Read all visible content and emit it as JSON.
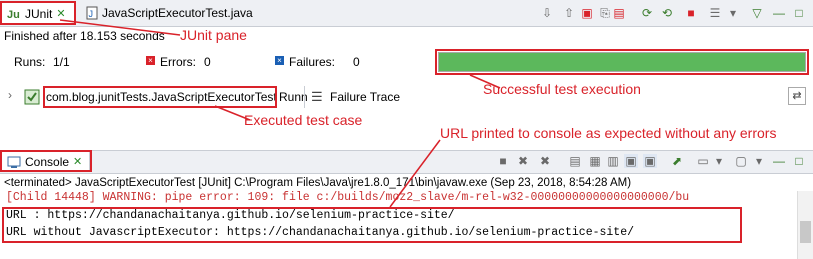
{
  "junit_view": {
    "tabs": [
      {
        "label": "JUnit",
        "icon": "junit-icon",
        "close_icon": "close-icon"
      },
      {
        "label": "JavaScriptExecutorTest.java",
        "icon": "java-file-icon"
      }
    ],
    "status_text": "Finished after 18.153 seconds",
    "runs_label": "Runs:",
    "runs_value": "1/1",
    "errors_label": "Errors:",
    "errors_value": "0",
    "failures_label": "Failures:",
    "failures_value": "0",
    "progress_fraction": 1.0,
    "progress_color": "#5cb85c",
    "test_item": "com.blog.junitTests.JavaScriptExecutorTest",
    "test_item_suffix": "Runn",
    "failure_trace_label": "Failure Trace"
  },
  "console_view": {
    "tab_label": "Console",
    "terminated_line": "<terminated> JavaScriptExecutorTest [JUnit] C:\\Program Files\\Java\\jre1.8.0_171\\bin\\javaw.exe (Sep 23, 2018, 8:54:28 AM)",
    "lines": [
      {
        "text": "[Child 14448] WARNING: pipe error: 109: file c:/builds/moz2_slave/m-rel-w32-00000000000000000000/bu",
        "color": "#c83232"
      },
      {
        "text": "URL : https://chandanachaitanya.github.io/selenium-practice-site/",
        "color": "#000000"
      },
      {
        "text": "URL without JavascriptExecutor: https://chandanachaitanya.github.io/selenium-practice-site/",
        "color": "#000000"
      }
    ]
  },
  "annotations": {
    "junit_pane": "JUnit pane",
    "successful_execution": "Successful test execution",
    "executed_test_case": "Executed test case",
    "console_note": "URL printed to console as expected without any errors"
  },
  "colors": {
    "annotation": "#d9222a",
    "accent_blue": "#1a5fb4"
  }
}
